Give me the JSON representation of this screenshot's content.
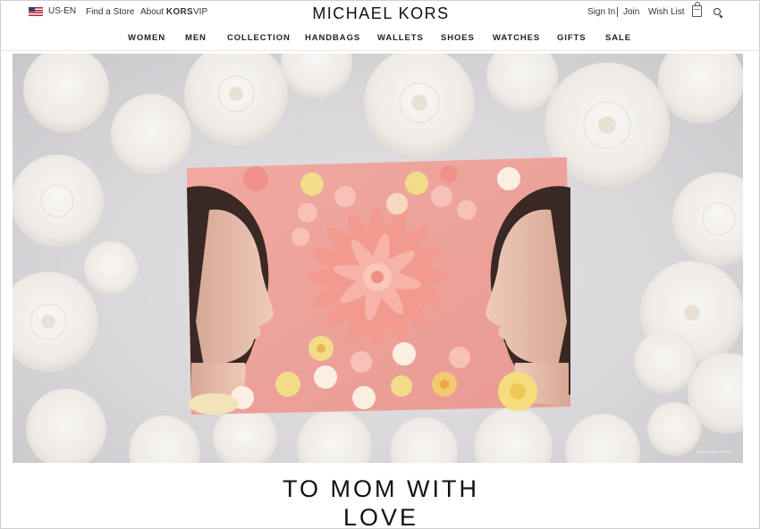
{
  "utility": {
    "locale": "US-EN",
    "find_store": "Find a Store",
    "about_prefix": "About ",
    "about_brand": "KORS",
    "about_suffix": "VIP",
    "sign_in": "Sign In",
    "join": "Join",
    "wish_list": "Wish List"
  },
  "brand": "MICHAEL KORS",
  "nav": {
    "items": [
      "WOMEN",
      "MEN",
      "COLLECTION",
      "HANDBAGS",
      "WALLETS",
      "SHOES",
      "WATCHES",
      "GIFTS",
      "SALE"
    ]
  },
  "hero": {
    "watermark": "MICHAEL KORS"
  },
  "headline": {
    "line1": "TO MOM WITH",
    "line2": "LOVE"
  },
  "icons": {
    "flag": "us-flag-icon",
    "bag": "shopping-bag-icon",
    "search": "search-icon"
  },
  "colors": {
    "card_pink": "#eda59d",
    "flower_white": "#f4f1ee",
    "flower_yellow": "#f2dc8a"
  }
}
